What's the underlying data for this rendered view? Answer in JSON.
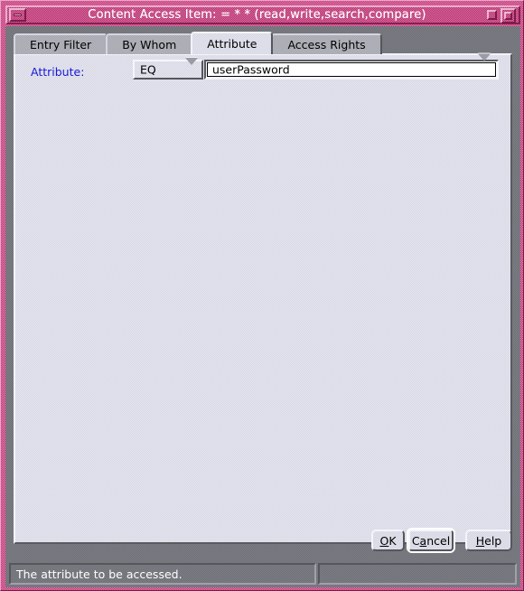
{
  "window": {
    "title": "Content Access Item:  = * * (read,write,search,compare)",
    "minimize_icon": "minimize-icon",
    "restore_icon": "restore-icon",
    "maximize_icon": "maximize-icon"
  },
  "tabs": [
    {
      "label": "Entry Filter",
      "selected": false
    },
    {
      "label": "By Whom",
      "selected": false
    },
    {
      "label": "Attribute",
      "selected": true
    },
    {
      "label": "Access Rights",
      "selected": false
    }
  ],
  "form": {
    "attribute_label": "Attribute:",
    "operator": {
      "value": "EQ",
      "arrow_icon": "chevron-down-icon"
    },
    "attribute_value": {
      "value": "userPassword",
      "placeholder": "",
      "arrow_icon": "chevron-down-icon"
    }
  },
  "buttons": {
    "ok": {
      "label": "OK",
      "mnemonic": "O"
    },
    "cancel": {
      "label": "Cancel",
      "mnemonic": "a"
    },
    "help": {
      "label": "Help",
      "mnemonic": "H"
    }
  },
  "statusbar": {
    "message": "The attribute to be accessed.",
    "secondary": ""
  },
  "colors": {
    "titlebar": "#c23a78",
    "label_blue": "#1818d8",
    "panel": "#dcdde8",
    "dialog": "#777880",
    "field_bg": "#ffffff"
  }
}
